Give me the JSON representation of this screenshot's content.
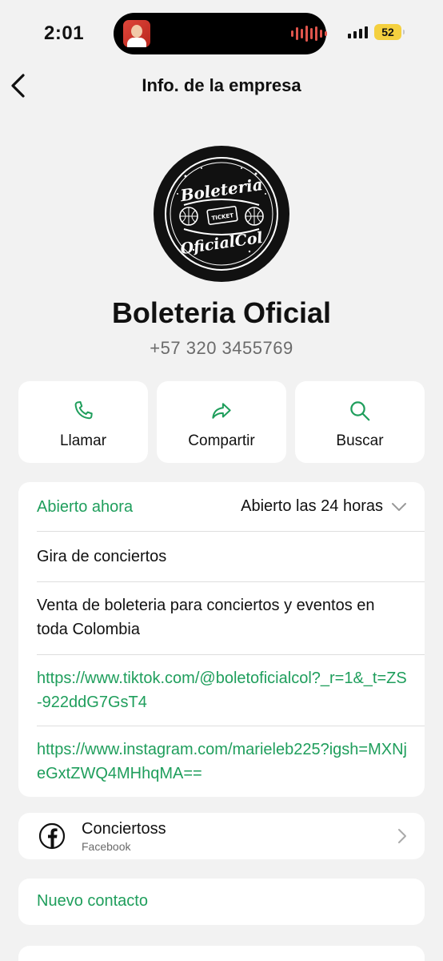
{
  "status_bar": {
    "time": "2:01",
    "battery": "52"
  },
  "nav": {
    "title": "Info. de la empresa"
  },
  "logo": {
    "line1": "Boleteria",
    "line2": "OficialCol",
    "ticket": "TICKET"
  },
  "business": {
    "name": "Boleteria Oficial",
    "phone": "+57 320 3455769"
  },
  "actions": [
    {
      "label": "Llamar",
      "icon": "phone-icon"
    },
    {
      "label": "Compartir",
      "icon": "share-arrow-icon"
    },
    {
      "label": "Buscar",
      "icon": "search-icon"
    }
  ],
  "info": {
    "open_status": "Abierto ahora",
    "hours": "Abierto las 24 horas",
    "category": "Gira de conciertos",
    "description": "Venta de boleteria para conciertos y eventos en toda Colombia",
    "links": [
      "https://www.tiktok.com/@boletoficialcol?_r=1&_t=ZS-922ddG7GsT4",
      "https://www.instagram.com/marieleb225?igsh=MXNjeGxtZWQ4MHhqMA=="
    ]
  },
  "facebook": {
    "title": "Conciertoss",
    "subtitle": "Facebook"
  },
  "new_contact": {
    "label": "Nuevo contacto"
  },
  "colors": {
    "accent": "#1f9e5c",
    "background": "#f2f2f2",
    "card": "#ffffff"
  }
}
